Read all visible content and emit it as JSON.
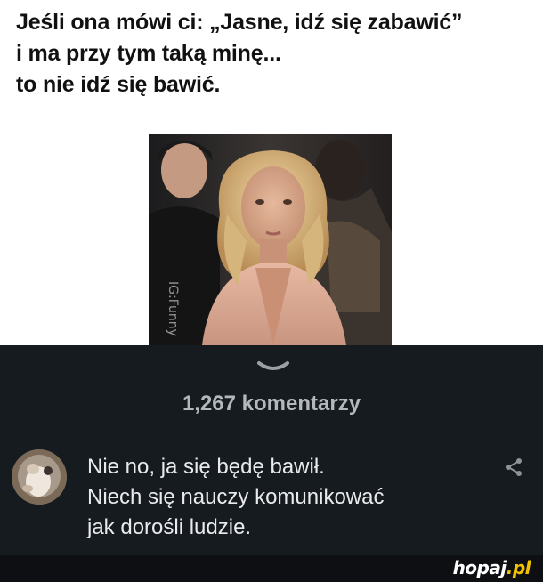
{
  "meme": {
    "caption_lines": [
      "Jeśli ona mówi ci: „Jasne, idź się zabawić”",
      "i ma przy tym taką minę...",
      "to nie idź się bawić."
    ],
    "photo_watermark": "IG:Funny"
  },
  "comments": {
    "count_label": "1,267 komentarzy",
    "expand_icon": "chevron-down-icon",
    "items": [
      {
        "text_lines": [
          "Nie no, ja się będę bawił.",
          "Niech się nauczy komunikować",
          "jak dorośli ludzie."
        ],
        "share_icon": "share-icon"
      }
    ]
  },
  "footer": {
    "brand_name": "hopaj",
    "brand_tld": ".pl"
  },
  "colors": {
    "dark_background": "#161b20",
    "footer_background": "#0d0f12",
    "brand_accent": "#f2c200"
  }
}
